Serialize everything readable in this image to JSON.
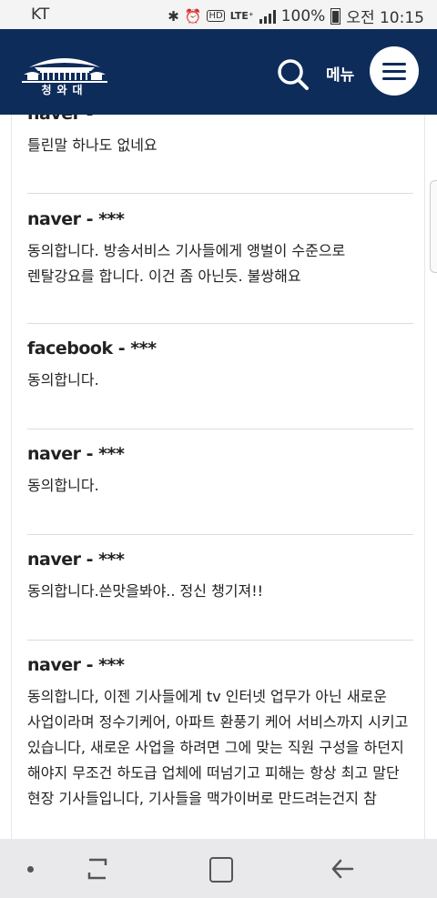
{
  "status_bar": {
    "carrier": "KT",
    "lte": "LTE⁺",
    "battery": "100%",
    "time": "오전 10:15"
  },
  "header": {
    "logo_text": "청와대",
    "menu_label": "메뉴"
  },
  "comments": [
    {
      "author": "naver -",
      "text": "틀린말 하나도 없네요"
    },
    {
      "author": "naver - ***",
      "text": "동의합니다. 방송서비스 기사들에게 앵벌이 수준으로 렌탈강요를 합니다. 이건 좀 아닌듯. 불쌍해요"
    },
    {
      "author": "facebook - ***",
      "text": "동의합니다."
    },
    {
      "author": "naver - ***",
      "text": "동의합니다."
    },
    {
      "author": "naver - ***",
      "text": "동의합니다.쓴맛을봐야.. 정신 챙기져!!"
    },
    {
      "author": "naver - ***",
      "text": "동의합니다, 이젠 기사들에게 tv 인터넷 업무가 아닌 새로운 사업이라며 정수기케어, 아파트 환풍기 케어 서비스까지 시키고 있습니다, 새로운 사업을 하려면 그에 맞는 직원 구성을 하던지 해야지 무조건 하도급 업체에 떠넘기고 피해는 항상 최고 말단 현장 기사들입니다, 기사들을 맥가이버로 만드려는건지 참"
    }
  ],
  "colors": {
    "header_bg": "#0e2c5a",
    "page_bg": "#ffffff",
    "divider": "#dcdcdc"
  },
  "icons": [
    "bluetooth-icon",
    "alarm-icon",
    "hd-icon",
    "signal-icon",
    "battery-icon",
    "search-icon",
    "hamburger-menu-icon",
    "recent-apps-icon",
    "home-icon",
    "back-icon"
  ]
}
